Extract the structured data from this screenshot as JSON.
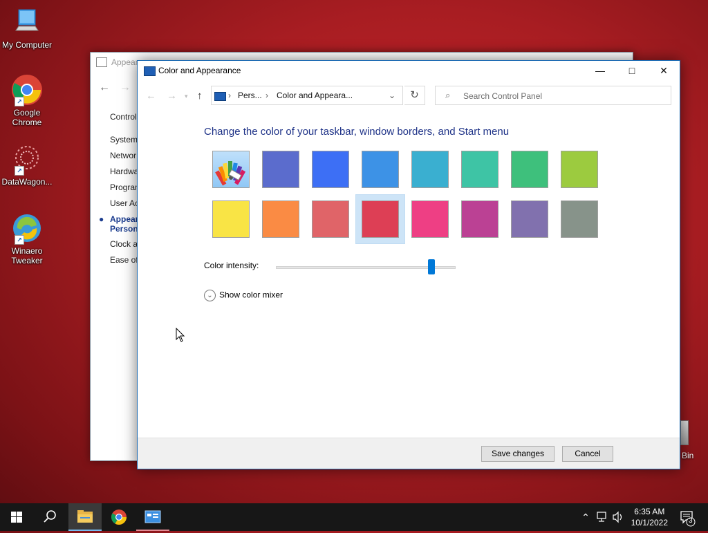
{
  "desktop": {
    "icons": [
      {
        "label": "My Computer",
        "icon": "computer-icon"
      },
      {
        "label": "Google Chrome",
        "icon": "chrome-icon"
      },
      {
        "label": "DataWagon...",
        "icon": "datawagon-icon"
      },
      {
        "label": "Winaero Tweaker",
        "icon": "winaero-icon"
      },
      {
        "label": "Bin",
        "icon": "recycle-bin-icon"
      }
    ]
  },
  "background_window": {
    "title": "Appear",
    "sidebar": [
      "Control",
      "System",
      "Networ",
      "Hardwa",
      "Program",
      "User Ac",
      "Appear",
      "Persona",
      "Clock a",
      "Ease of"
    ]
  },
  "window": {
    "title": "Color and Appearance",
    "breadcrumb": [
      "Pers...",
      "Color and Appeara..."
    ],
    "search_placeholder": "Search Control Panel",
    "heading": "Change the color of your taskbar, window borders, and Start menu",
    "swatches": [
      {
        "color": "automatic",
        "icon": "color-palette-icon"
      },
      {
        "color": "#5b6ccd"
      },
      {
        "color": "#3d6ff5"
      },
      {
        "color": "#3d92e6"
      },
      {
        "color": "#3aafd0"
      },
      {
        "color": "#3ec4a5"
      },
      {
        "color": "#3ec07c"
      },
      {
        "color": "#9ccb3f"
      },
      {
        "color": "#f9e445"
      },
      {
        "color": "#fa8b44"
      },
      {
        "color": "#e06468"
      },
      {
        "color": "#dd3f55",
        "selected": true
      },
      {
        "color": "#ee3f84"
      },
      {
        "color": "#bb4194"
      },
      {
        "color": "#8171ae"
      },
      {
        "color": "#87938a"
      }
    ],
    "intensity_label": "Color intensity:",
    "intensity_value": 0.86,
    "mixer_label": "Show color mixer",
    "save_label": "Save changes",
    "cancel_label": "Cancel"
  },
  "taskbar": {
    "time": "6:35 AM",
    "date": "10/1/2022",
    "notification_count": "3",
    "accent": "#76b9ed"
  }
}
